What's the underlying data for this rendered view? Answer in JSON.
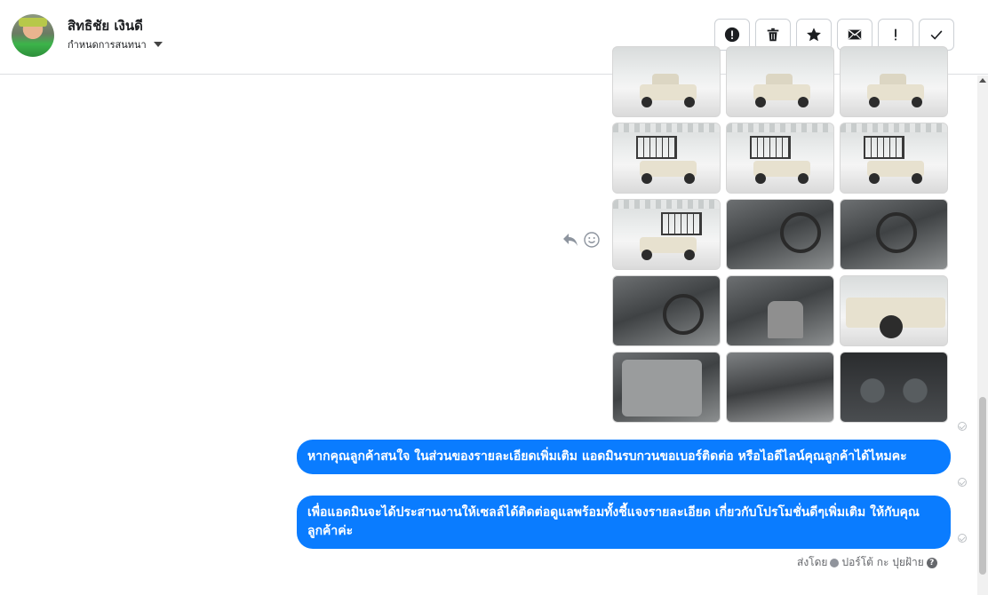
{
  "header": {
    "user_name": "สิทธิชัย เงินดี",
    "conversation_setting": "กำหนดการสนทนา",
    "toolbar": {
      "spam_icon": "alert-circle-icon",
      "delete_icon": "trash-icon",
      "star_icon": "star-icon",
      "mark_unread_icon": "envelope-icon",
      "important_icon": "exclamation-icon",
      "done_icon": "check-icon"
    }
  },
  "attachments": {
    "images": [
      "car-front-showroom",
      "car-front-showroom",
      "car-front-showroom",
      "truck-rack-rear",
      "truck-rack-rear",
      "truck-rack-side",
      "truck-rack-side",
      "interior-gear",
      "interior-dash",
      "interior-dash",
      "interior-seat",
      "car-front-wheel",
      "door-panel",
      "engine-bay",
      "gauges"
    ]
  },
  "messages": [
    {
      "text": "หากคุณลูกค้าสนใจ ในส่วนของรายละเอียดเพิ่มเติม แอดมินรบกวนขอเบอร์ติดต่อ หรือไอดีไลน์คุณลูกค้าได้ไหมคะ"
    },
    {
      "text": "เพื่อแอดมินจะได้ประสานงานให้เซลล์ได้ติดต่อดูแลพร้อมทั้งชี้แจงรายละเอียด เกี่ยวกับโปรโมชั่นดีๆเพิ่มเติม ให้กับคุณลูกค้าค่ะ"
    }
  ],
  "sent_by": {
    "label": "ส่งโดย",
    "name": "ปอร์โต้ กะ ปุยฝ้าย",
    "help": "?"
  },
  "colors": {
    "bubble": "#0a7cff",
    "border": "#ccd0d5",
    "muted": "#65676b"
  }
}
